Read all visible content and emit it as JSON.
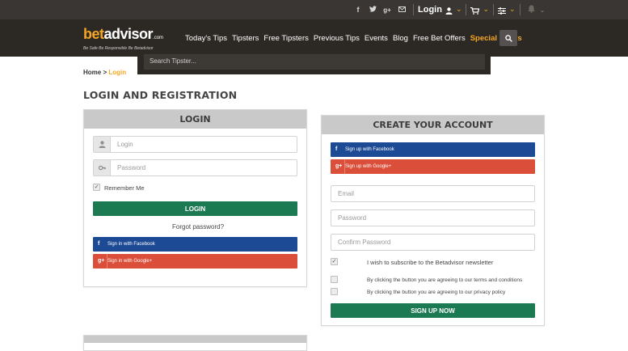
{
  "topbar": {
    "social_icons": [
      "facebook-icon",
      "twitter-icon",
      "googleplus-icon",
      "email-icon"
    ],
    "login_label": "Login",
    "accent": "#f5a623"
  },
  "nav": {
    "logo": {
      "bet": "bet",
      "advisor": "advisor",
      "com": ".com",
      "tagline": "Be Safe Be Responsible Be Betadvisor"
    },
    "items": [
      "Today's Tips",
      "Tipsters",
      "Free Tipsters",
      "Previous Tips",
      "Events",
      "Blog",
      "Free Bet Offers",
      "Special Offers"
    ]
  },
  "search": {
    "placeholder": "Search Tipster..."
  },
  "breadcrumb": {
    "home": "Home",
    "sep": ">",
    "current": "Login"
  },
  "page": {
    "title": "LOGIN AND REGISTRATION"
  },
  "login_panel": {
    "title": "LOGIN",
    "login_placeholder": "Login",
    "password_placeholder": "Password",
    "remember_label": "Remember Me",
    "remember_checked": true,
    "login_button": "LOGIN",
    "forgot": "Forgot password?",
    "facebook_button": "Sign in with Facebook",
    "google_button": "Sign in with Google+"
  },
  "account_panel": {
    "title": "CREATE YOUR ACCOUNT",
    "facebook_button": "Sign up with Facebook",
    "google_button": "Sign up with Google+",
    "email_placeholder": "Email",
    "password_placeholder": "Password",
    "confirm_placeholder": "Confirm Password",
    "newsletter_label": "I wish to subscribe to the Betadvisor newsletter",
    "newsletter_checked": true,
    "terms_label": "By clicking the button you are agreeing to our terms and conditions",
    "privacy_label": "By clicking the button you are agreeing to our privacy policy",
    "signup_button": "SIGN UP NOW"
  },
  "colors": {
    "green": "#1b7a52",
    "facebook": "#1d4a94",
    "google": "#db4f3a",
    "dark": "#2c2925"
  }
}
